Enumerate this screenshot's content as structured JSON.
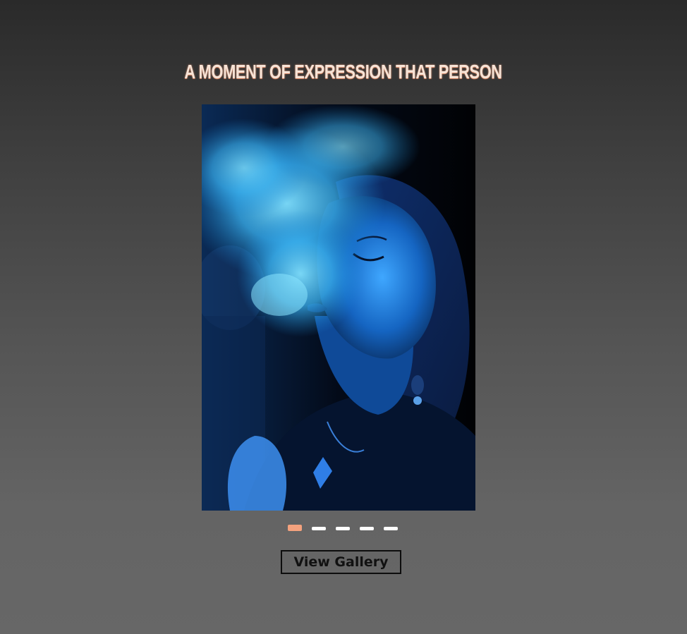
{
  "headline": "A MOMENT OF EXPRESSION THAT PERSON",
  "slider": {
    "slide_count": 5,
    "active_index": 0,
    "active_color": "#f4a27e",
    "inactive_color": "#ffffff"
  },
  "cta": {
    "label": "View Gallery"
  },
  "colors": {
    "background_top": "#2a2a2a",
    "background_bottom": "#676767",
    "photo_tint": "#1e8fe6"
  }
}
